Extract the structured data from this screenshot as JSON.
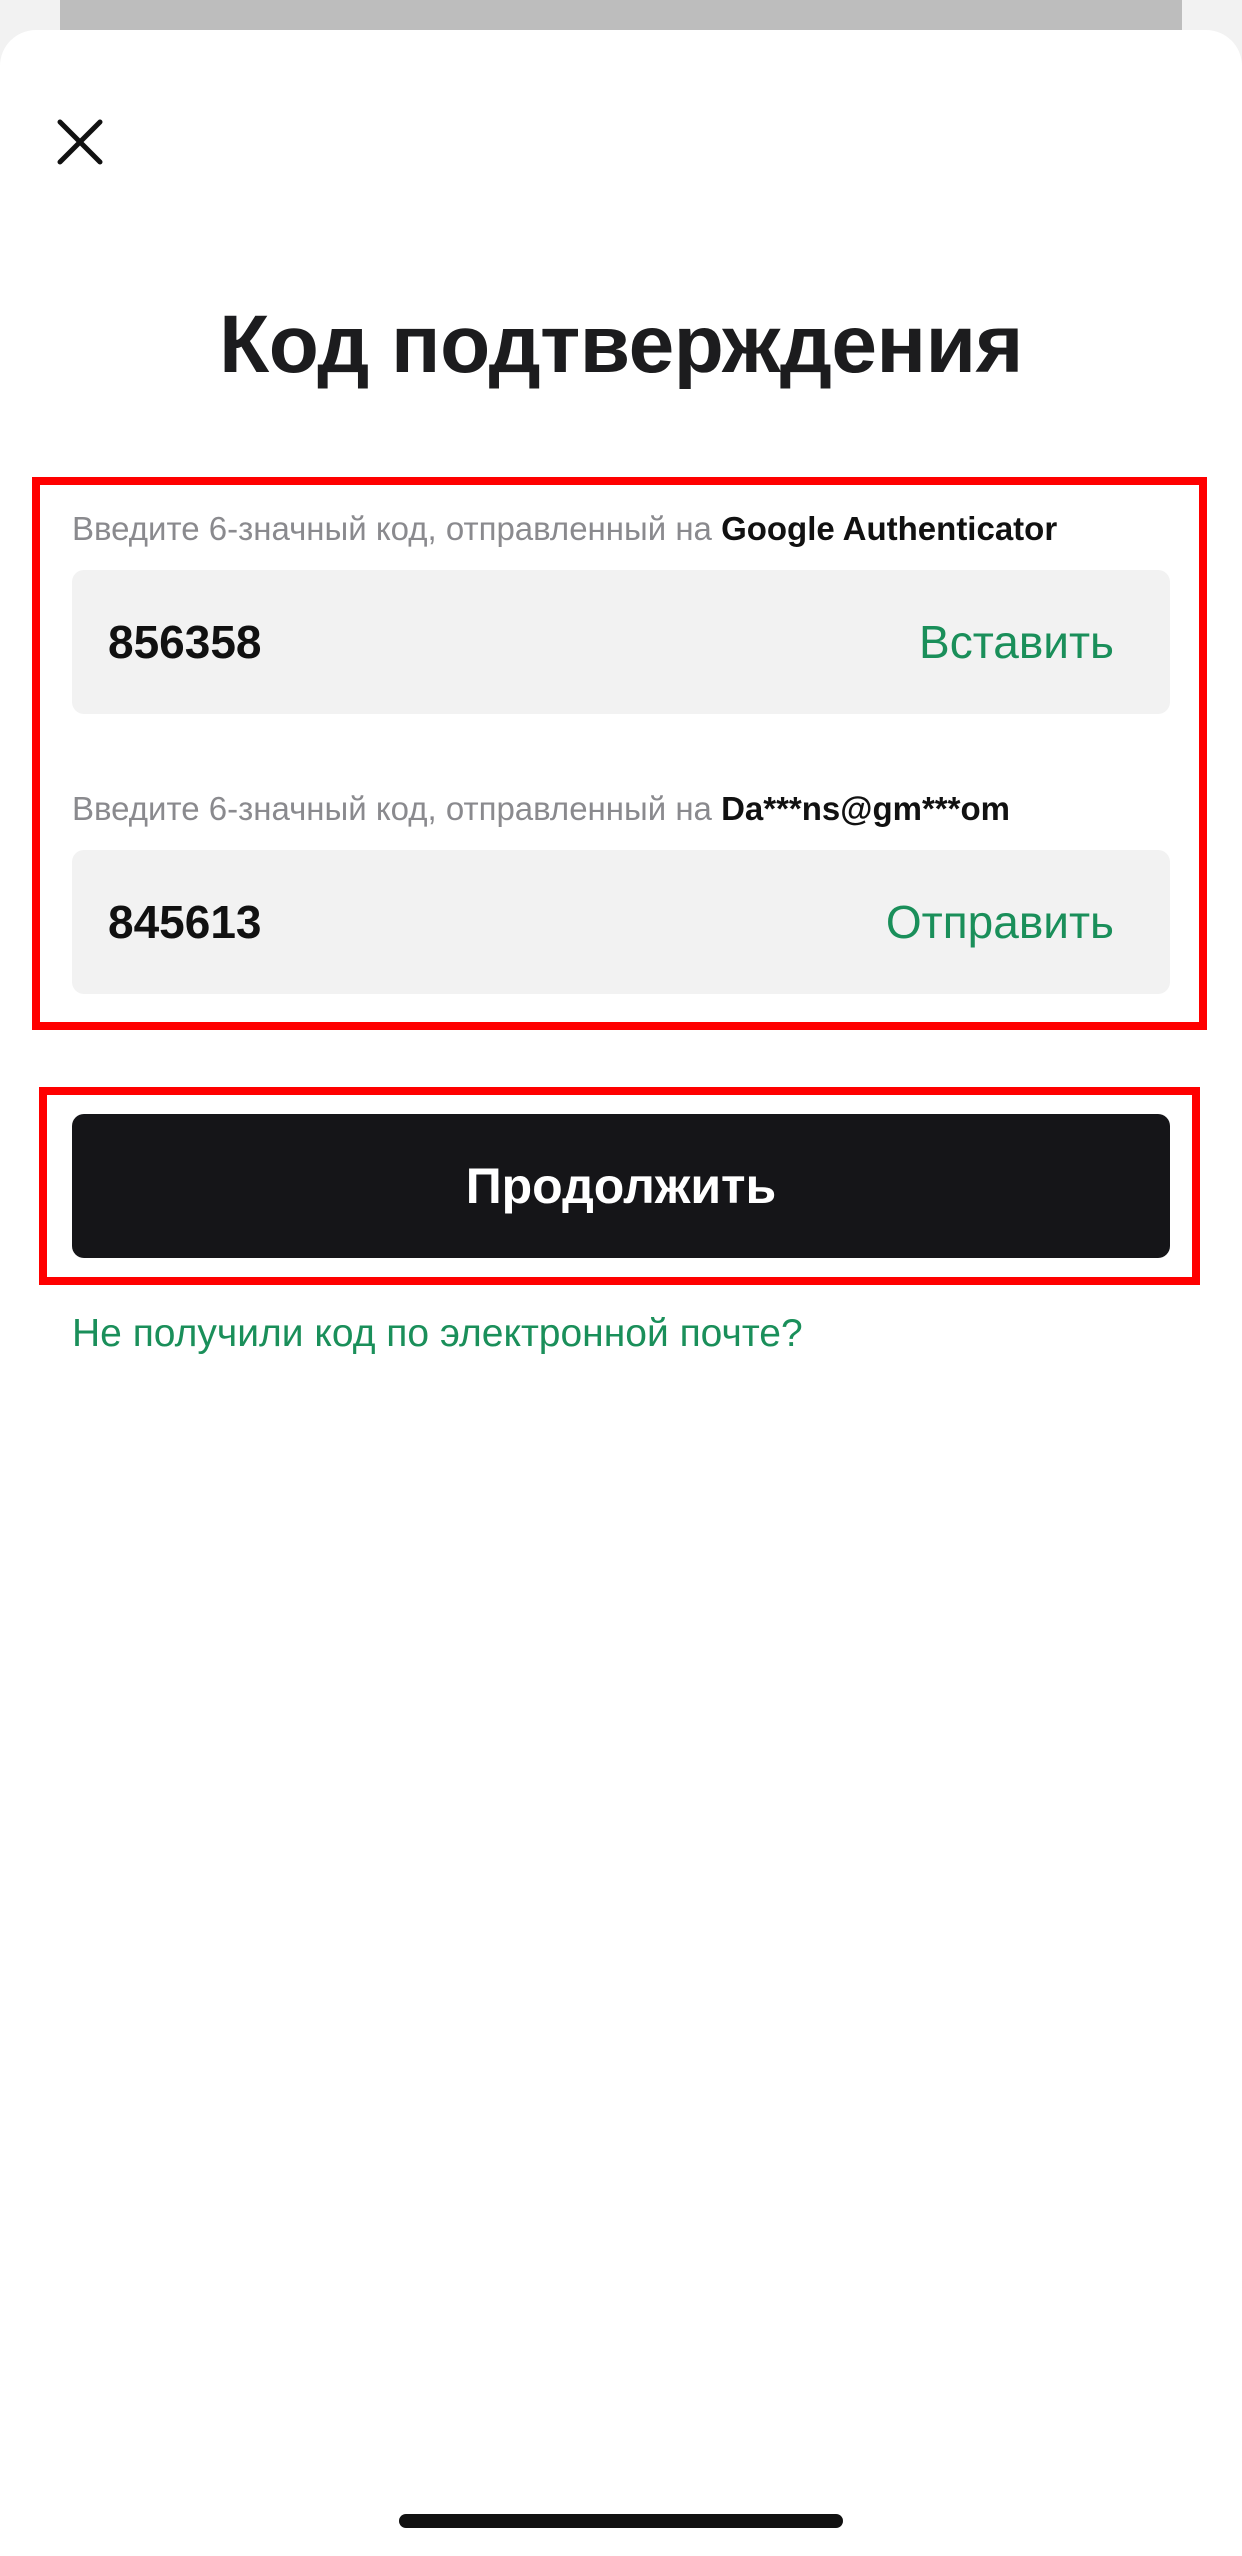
{
  "header": {
    "close_icon": "close-icon",
    "title": "Код подтверждения"
  },
  "authenticator": {
    "label_prefix": "Введите 6-значный код, отправленный на ",
    "label_target": "Google Authenticator",
    "code": "856358",
    "action_label": "Вставить"
  },
  "email": {
    "label_prefix": "Введите 6-значный код, отправленный на ",
    "label_target": "Da***ns@gm***om",
    "code": "845613",
    "action_label": "Отправить"
  },
  "actions": {
    "continue_label": "Продолжить",
    "help_link": "Не получили код по электронной почте?"
  },
  "colors": {
    "accent": "#1a8f5a",
    "primary_button": "#151518",
    "highlight": "#ff0000",
    "field_background": "#f2f2f2"
  }
}
